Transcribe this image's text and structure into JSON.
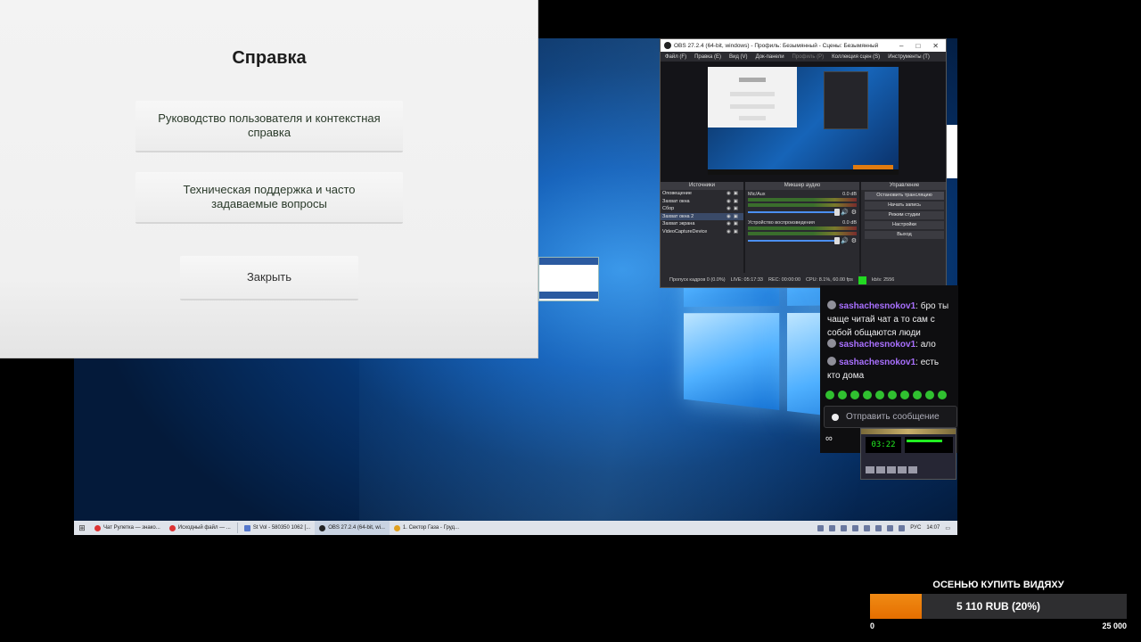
{
  "help_dialog": {
    "title": "Справка",
    "buttons": {
      "user_guide": "Руководство пользователя и контекстная справка",
      "support_faq": "Техническая поддержка и часто задаваемые вопросы",
      "close": "Закрыть"
    }
  },
  "obs": {
    "window_title": "OBS 27.2.4 (64-bit, windows) - Профиль: Безымянный - Сцены: Безымянный",
    "menu": [
      "Файл (F)",
      "Правка (E)",
      "Вид (V)",
      "Док-панели"
    ],
    "menu_disabled": "Профиль (P)",
    "menu_more": [
      "Коллекция сцен (S)",
      "Инструменты (T)"
    ],
    "docks": {
      "sources_header": "Источники",
      "mixer_header": "Микшер аудио",
      "controls_header": "Управление"
    },
    "sources": [
      "Оповещение",
      "Захват окна",
      "Сбор",
      "Захват окна 2",
      "Захват экрана",
      "VideoCaptureDevice"
    ],
    "mixer": [
      {
        "name": "Mic/Aux",
        "level": "0.0 dB"
      },
      {
        "name": "Устройство воспроизведения",
        "level": "0.0 dB"
      }
    ],
    "controls": [
      "Остановить трансляцию",
      "Начать запись",
      "Режим студии",
      "Настройки",
      "Выход"
    ],
    "status": {
      "dropped": "Пропуск кадров 0 (0.0%)",
      "live": "LIVE: 05:17:33",
      "rec": "REC: 00:00:00",
      "cpu": "CPU: 8.1%, 60.00 fps",
      "kbps": "kb/s: 2556"
    }
  },
  "chat": {
    "messages": [
      {
        "user": "sashachesnokov1",
        "text": ": бро ты чаще читай чат а то сам с собой общаются люди"
      },
      {
        "user": "sashachesnokov1",
        "text": ": ало"
      },
      {
        "user": "sashachesnokov1",
        "text": ": есть кто дома"
      }
    ],
    "input_placeholder": "Отправить сообщение",
    "bottom_label": "∞"
  },
  "winamp": {
    "time": "03:22"
  },
  "taskbar": {
    "items": [
      "Чат Рулетка — знако...",
      "Исходный файл — ...",
      "St Vol - 580350 1062 [...",
      "OBS 27.2.4 (64-bit, wi...",
      "1. Сектор Газа - Груд..."
    ],
    "lang": "РУС",
    "time": "14:07"
  },
  "donation_goal": {
    "title": "ОСЕНЬЮ КУПИТЬ ВИДЯХУ",
    "progress_text": "5 110 RUB (20%)",
    "progress_fraction": 0.2,
    "min_label": "0",
    "max_label": "25 000"
  }
}
